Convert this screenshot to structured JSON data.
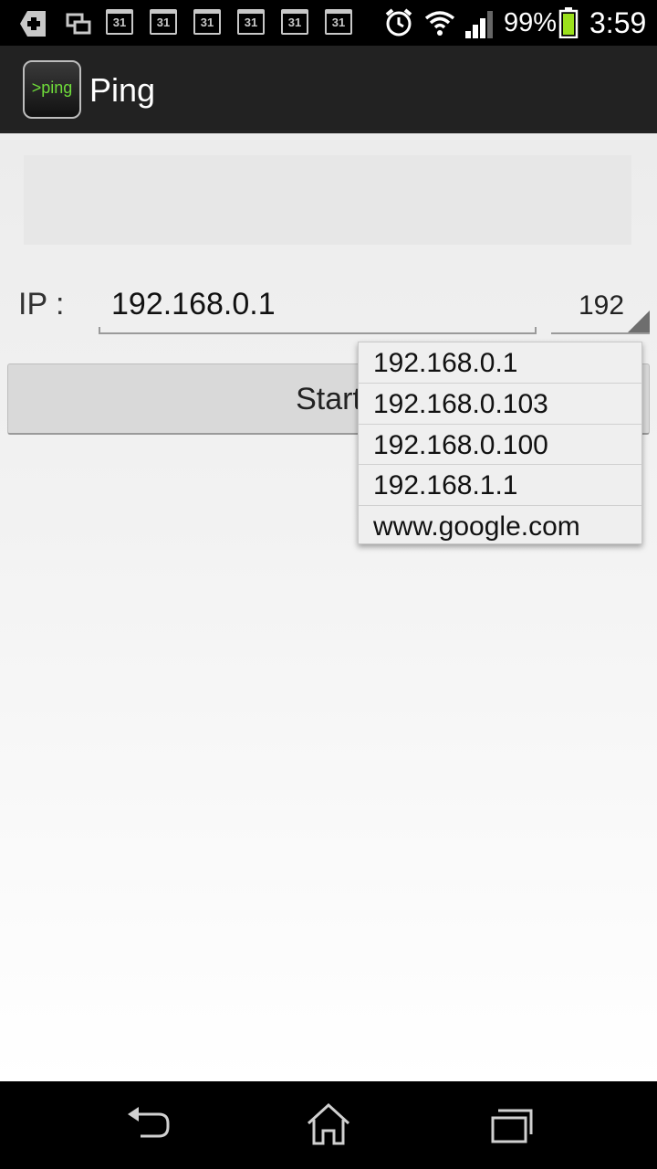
{
  "status_bar": {
    "notification_icons": [
      "plus-icon",
      "screens-icon",
      "calendar-icon",
      "calendar-icon",
      "calendar-icon",
      "calendar-icon",
      "calendar-icon",
      "calendar-icon"
    ],
    "calendar_day": "31",
    "battery_percent": "99%",
    "time": "3:59"
  },
  "action_bar": {
    "icon_text": ">ping",
    "title": "Ping"
  },
  "form": {
    "ip_label": "IP :",
    "ip_value": "192.168.0.1",
    "spinner_value": "192",
    "start_label": "Start"
  },
  "dropdown": {
    "items": [
      "192.168.0.1",
      "192.168.0.103",
      "192.168.0.100",
      "192.168.1.1",
      "www.google.com"
    ]
  },
  "colors": {
    "action_bar_bg": "#222222",
    "icon_text_color": "#6fdc3a",
    "battery_color": "#9be01c"
  }
}
